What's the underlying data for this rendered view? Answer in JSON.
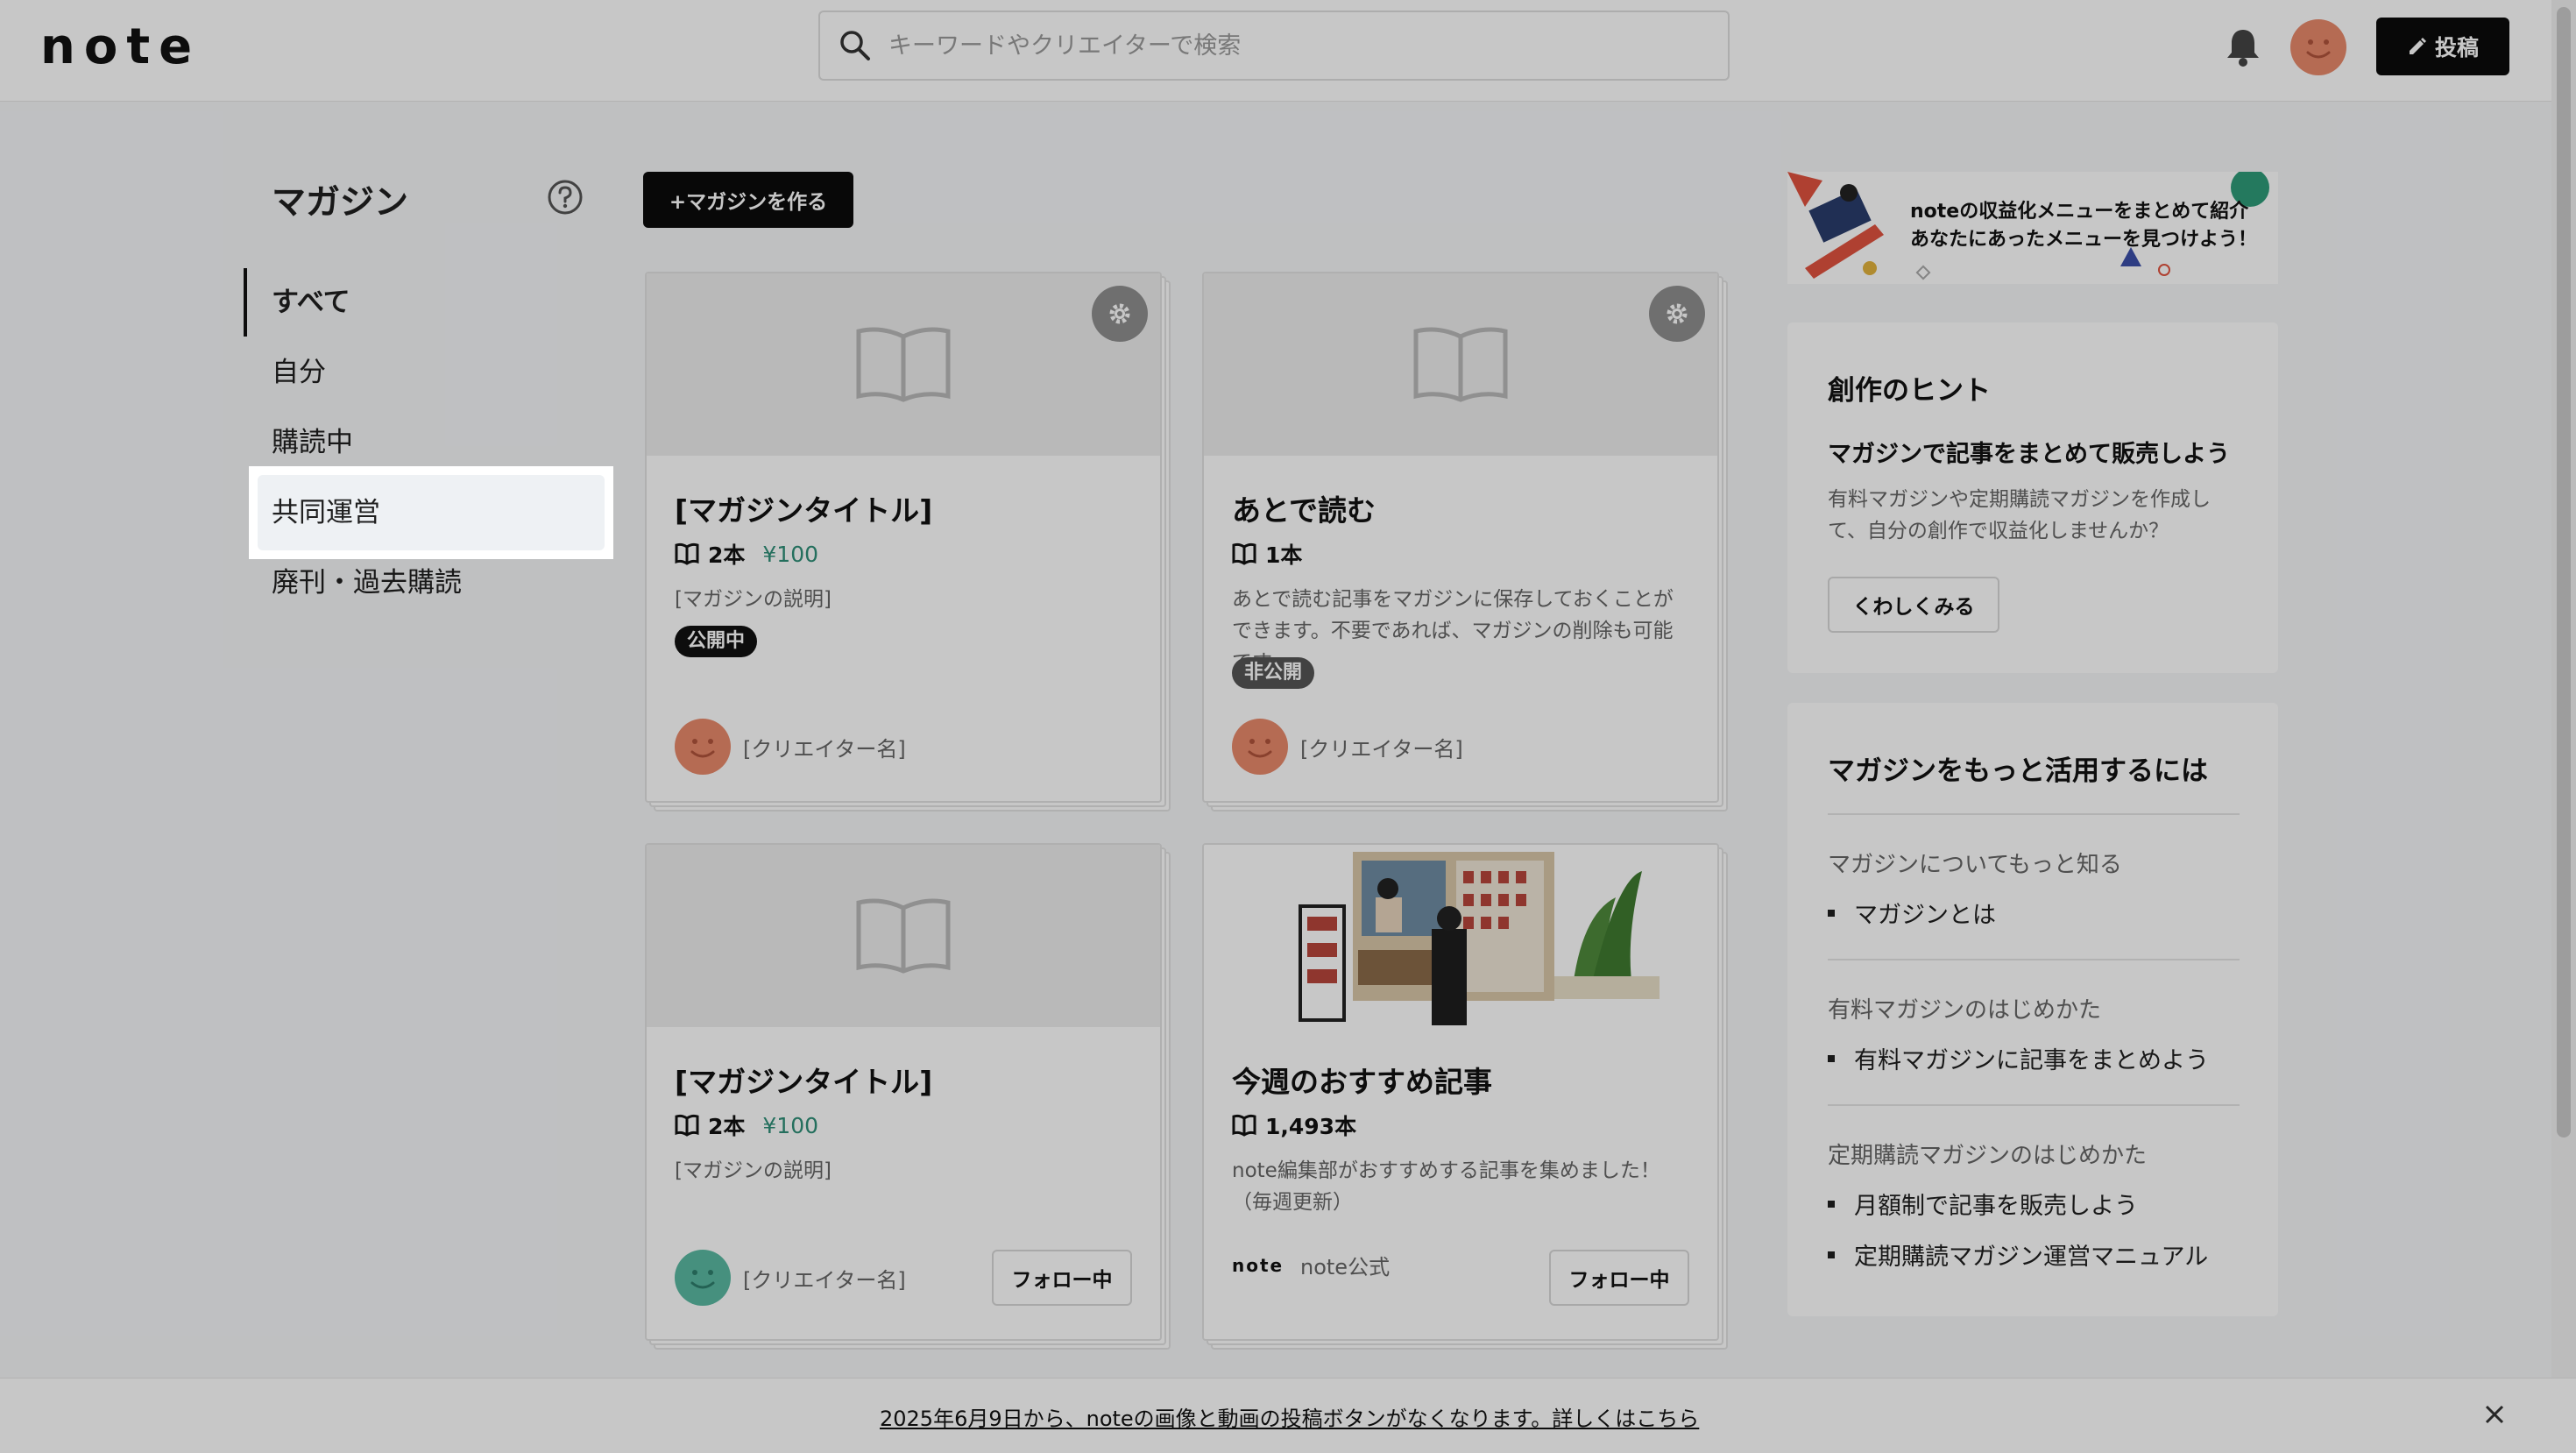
{
  "header": {
    "logo": "note",
    "search_placeholder": "キーワードやクリエイターで検索",
    "post_label": "投稿"
  },
  "sidebar": {
    "title": "マガジン",
    "items": [
      {
        "label": "すべて"
      },
      {
        "label": "自分"
      },
      {
        "label": "購読中"
      },
      {
        "label": "共同運営"
      },
      {
        "label": "廃刊・過去購読"
      }
    ]
  },
  "main": {
    "create_label": "+マガジンを作る",
    "cards": [
      {
        "title": "[マガジンタイトル]",
        "count": "2本",
        "price": "¥100",
        "description": "[マガジンの説明]",
        "badge": "公開中",
        "creator": "[クリエイター名]"
      },
      {
        "title": "あとで読む",
        "count": "1本",
        "description": "あとで読む記事をマガジンに保存しておくことができます。不要であれば、マガジンの削除も可能です。",
        "badge": "非公開",
        "creator": "[クリエイター名]"
      },
      {
        "title": "[マガジンタイトル]",
        "count": "2本",
        "price": "¥100",
        "description": "[マガジンの説明]",
        "creator": "[クリエイター名]",
        "follow_label": "フォロー中"
      },
      {
        "title": "今週のおすすめ記事",
        "count": "1,493本",
        "description": "note編集部がおすすめする記事を集めました！（毎週更新）",
        "creator": "note公式",
        "creator_logo": "note",
        "follow_label": "フォロー中"
      }
    ]
  },
  "right": {
    "banner_line1": "noteの収益化メニューをまとめて紹介",
    "banner_line2": "あなたにあったメニューを見つけよう！",
    "hint": {
      "title": "創作のヒント",
      "subtitle": "マガジンで記事をまとめて販売しよう",
      "body": "有料マガジンや定期購読マガジンを作成して、自分の創作で収益化しませんか？",
      "button": "くわしくみる"
    },
    "usage": {
      "title": "マガジンをもっと活用するには",
      "sections": [
        {
          "label": "マガジンについてもっと知る",
          "links": [
            "マガジンとは"
          ]
        },
        {
          "label": "有料マガジンのはじめかた",
          "links": [
            "有料マガジンに記事をまとめよう"
          ]
        },
        {
          "label": "定期購読マガジンのはじめかた",
          "links": [
            "月額制で記事を販売しよう",
            "定期購読マガジン運営マニュアル"
          ]
        }
      ]
    }
  },
  "footer": {
    "notice": "2025年6月9日から、noteの画像と動画の投稿ボタンがなくなります。詳しくはこちら"
  },
  "colors": {
    "accent_dark": "#0b0b0b",
    "price_green": "#2f8f78",
    "avatar_orange": "#e8896b",
    "avatar_teal": "#5ab9a2"
  }
}
